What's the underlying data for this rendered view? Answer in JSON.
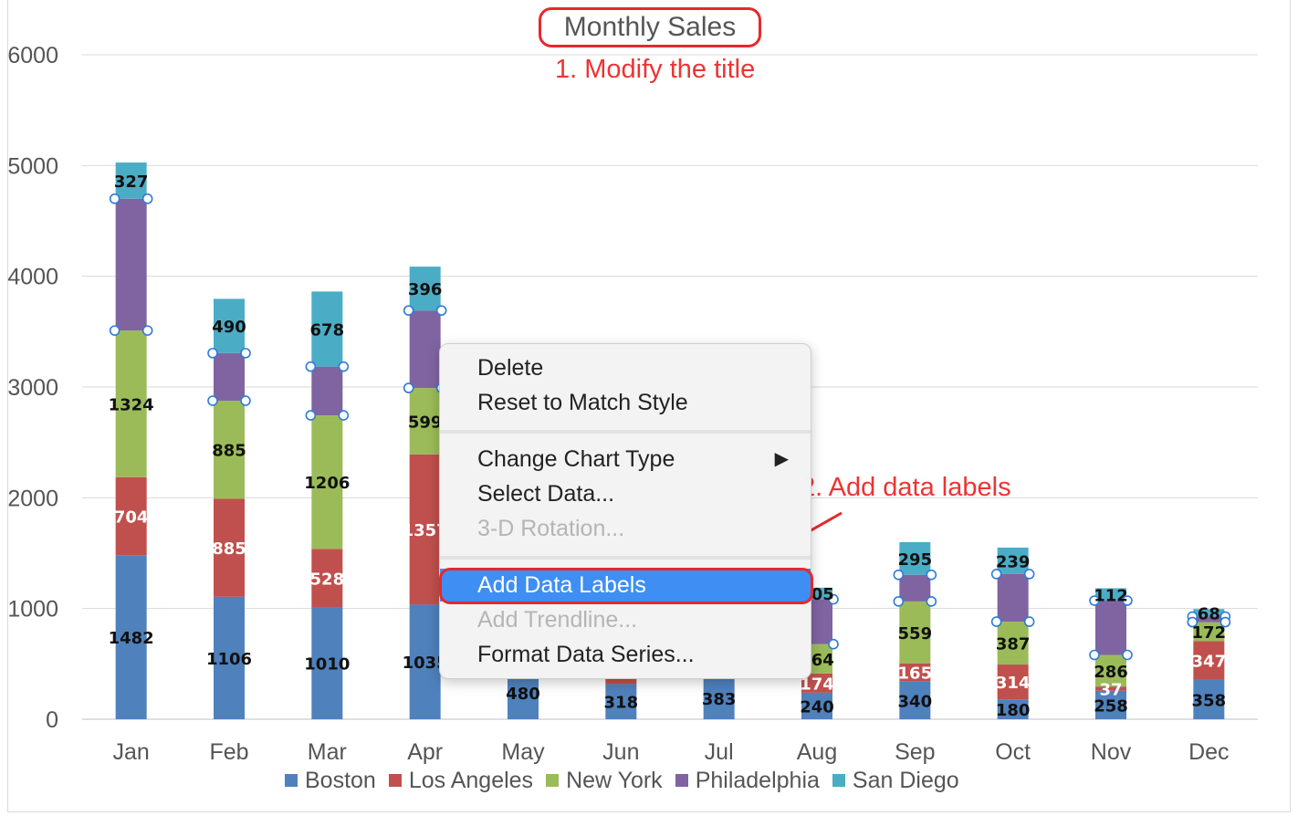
{
  "chart": {
    "title": "Monthly Sales",
    "annotation_1": "1. Modify the title",
    "annotation_2": "2. Add data labels"
  },
  "context_menu": {
    "delete": "Delete",
    "reset": "Reset to Match Style",
    "change_type": "Change Chart Type",
    "select_data": "Select Data...",
    "rotation_3d": "3-D Rotation...",
    "add_labels": "Add Data Labels",
    "add_trendline": "Add Trendline...",
    "format_series": "Format Data Series...",
    "submenu_arrow": "▶"
  },
  "colors": {
    "Boston": "#4f81bd",
    "Los Angeles": "#c0504d",
    "New York": "#9bbb59",
    "Philadelphia": "#8064a2",
    "San Diego": "#4bacc6",
    "annotation": "#e8282b",
    "menu_highlight": "#3f8ef3"
  },
  "chart_data": {
    "type": "bar",
    "stacked": true,
    "title": "Monthly Sales",
    "categories": [
      "Jan",
      "Feb",
      "Mar",
      "Apr",
      "May",
      "Jun",
      "Jul",
      "Aug",
      "Sep",
      "Oct",
      "Nov",
      "Dec"
    ],
    "ylim": [
      0,
      6000
    ],
    "yticks": [
      0,
      1000,
      2000,
      3000,
      4000,
      5000,
      6000
    ],
    "grid": true,
    "legend_position": "bottom",
    "series": [
      {
        "name": "Boston",
        "values": [
          1482,
          1106,
          1010,
          1035,
          480,
          318,
          383,
          240,
          340,
          180,
          258,
          358
        ]
      },
      {
        "name": "Los Angeles",
        "values": [
          704,
          885,
          528,
          1357,
          0,
          70,
          0,
          174,
          165,
          314,
          37,
          347
        ]
      },
      {
        "name": "New York",
        "values": [
          1324,
          885,
          1206,
          599,
          0,
          0,
          0,
          264,
          559,
          387,
          286,
          172
        ]
      },
      {
        "name": "Philadelphia",
        "values": [
          1190,
          430,
          440,
          700,
          0,
          0,
          0,
          405,
          240,
          430,
          490,
          50
        ]
      },
      {
        "name": "San Diego",
        "values": [
          327,
          490,
          678,
          396,
          0,
          0,
          0,
          105,
          295,
          239,
          112,
          68
        ]
      }
    ],
    "data_labels": {
      "Boston": [
        1482,
        1106,
        1010,
        1035,
        480,
        318,
        383,
        240,
        340,
        180,
        258,
        358
      ],
      "Los Angeles": [
        704,
        885,
        528,
        1357,
        null,
        null,
        null,
        174,
        165,
        314,
        37,
        347
      ],
      "New York": [
        1324,
        885,
        1206,
        599,
        null,
        null,
        null,
        264,
        559,
        387,
        286,
        172
      ],
      "San Diego": [
        327,
        490,
        678,
        396,
        null,
        null,
        null,
        105,
        295,
        239,
        112,
        68
      ]
    }
  }
}
